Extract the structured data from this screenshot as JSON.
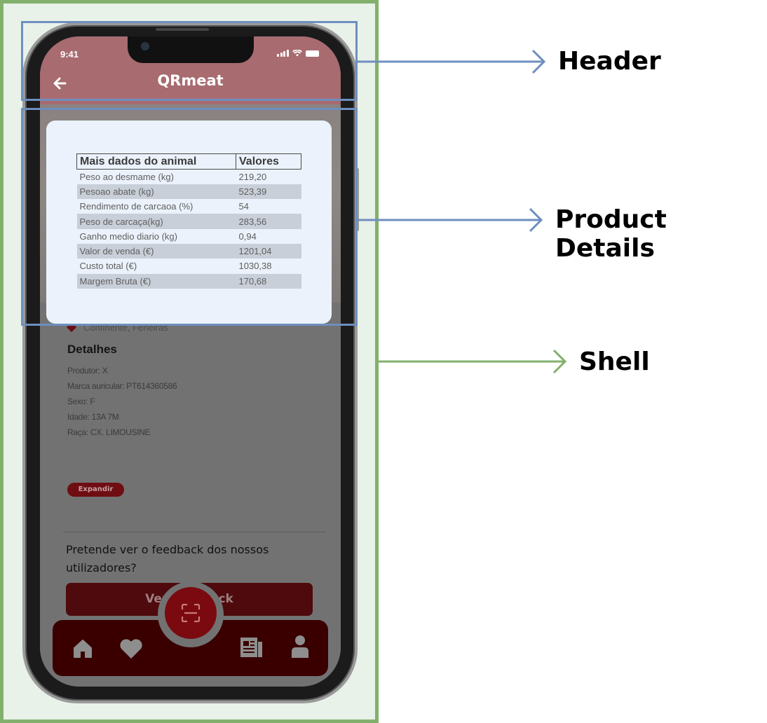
{
  "status_bar": {
    "time": "9:41"
  },
  "header": {
    "title": "QRmeat"
  },
  "modal": {
    "table": {
      "headers": [
        "Mais dados do animal",
        "Valores"
      ],
      "rows": [
        [
          "Peso ao desmame (kg)",
          "219,20"
        ],
        [
          "Pesoao abate (kg)",
          "523,39"
        ],
        [
          "Rendimento de carcaoa (%)",
          "54"
        ],
        [
          "Peso de carcaça(kg)",
          "283,56"
        ],
        [
          "Ganho medio diario (kg)",
          "0,94"
        ],
        [
          "Valor de venda (€)",
          "1201,04"
        ],
        [
          "Custo total (€)",
          "1030,38"
        ],
        [
          "Margem Bruta (€)",
          "170,68"
        ]
      ]
    }
  },
  "content": {
    "location": "Continente, Feneiras",
    "details_title": "Detalhes",
    "details": [
      "Produtor: X",
      "Marca auricular: PT614360586",
      "Sexo: F",
      "Idade: 13A 7M",
      "Raça: CX. LIMOUSINE"
    ],
    "expand_label": "Expandir",
    "feedback_question": "Pretende ver o feedback dos nossos utilizadores?",
    "feedback_button": "Ver feedback"
  },
  "nav": {
    "items": [
      "home-icon",
      "heart-icon",
      "scan-icon",
      "newspaper-icon",
      "user-icon"
    ]
  },
  "annotations": {
    "header": "Header",
    "product_details": "Product Details",
    "shell": "Shell"
  },
  "colors": {
    "header_bg": "#a86b70",
    "nav_bg": "#3a0000",
    "accent_red": "#7a0a0f",
    "annotation_blue": "#6e8fbf",
    "annotation_green": "#82b06c",
    "modal_bg": "#ebf2fb"
  }
}
